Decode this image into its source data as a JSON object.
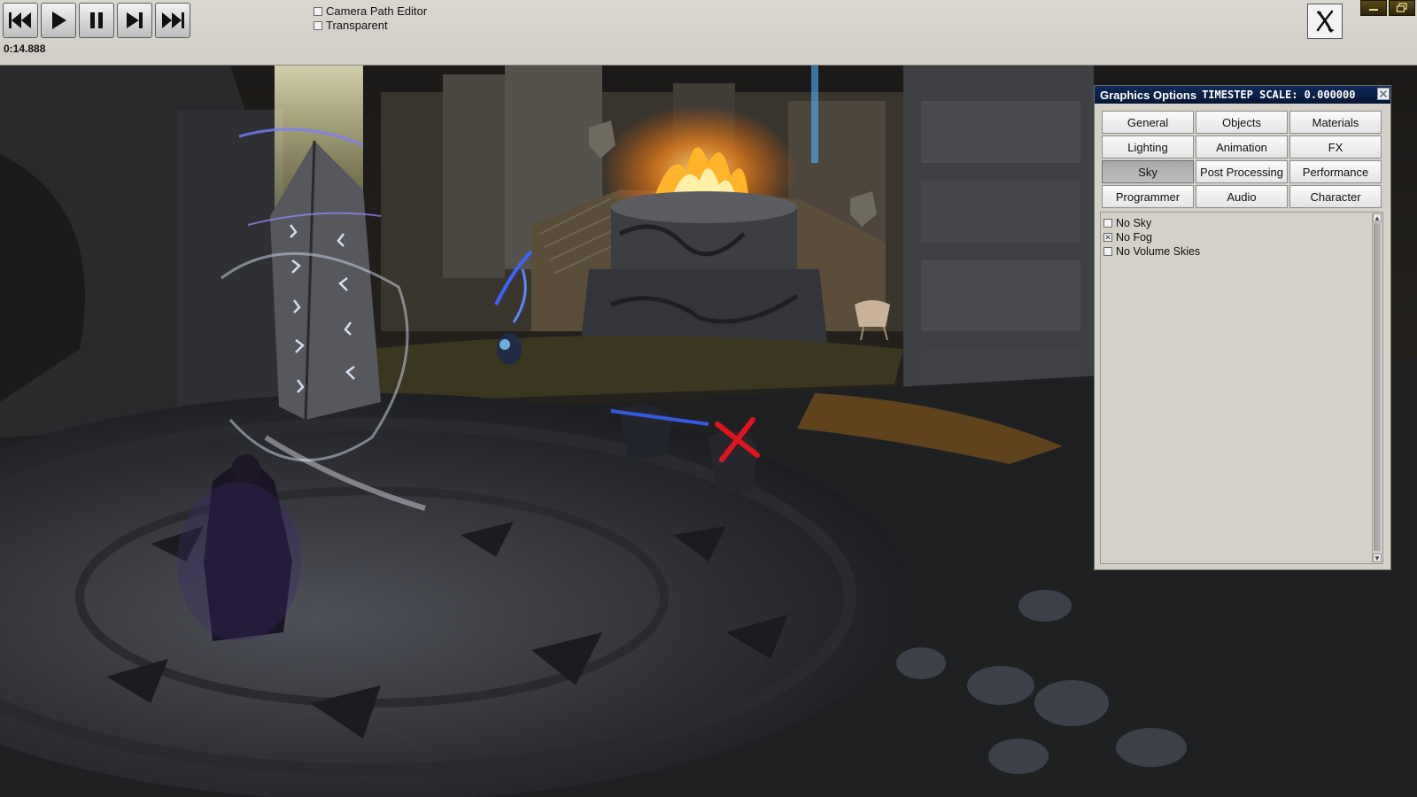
{
  "toolbar": {
    "buttons": [
      {
        "name": "rewind-button",
        "icon": "rewind-icon"
      },
      {
        "name": "play-button",
        "icon": "play-icon"
      },
      {
        "name": "pause-button",
        "icon": "pause-icon"
      },
      {
        "name": "step-forward-button",
        "icon": "step-forward-icon"
      },
      {
        "name": "fast-forward-button",
        "icon": "fast-forward-icon"
      }
    ],
    "time": "0:14.888",
    "camera_path_editor_label": "Camera Path Editor",
    "camera_path_editor_checked": false,
    "transparent_label": "Transparent",
    "transparent_checked": false,
    "close_icon": "x-icon",
    "window_controls": [
      "minimize-icon",
      "restore-icon"
    ]
  },
  "graphics_panel": {
    "title": "Graphics Options",
    "timestep": "TIMESTEP SCALE: 0.000000",
    "tabs": [
      {
        "label": "General"
      },
      {
        "label": "Objects"
      },
      {
        "label": "Materials"
      },
      {
        "label": "Lighting"
      },
      {
        "label": "Animation"
      },
      {
        "label": "FX"
      },
      {
        "label": "Sky",
        "active": true
      },
      {
        "label": "Post Processing"
      },
      {
        "label": "Performance"
      },
      {
        "label": "Programmer"
      },
      {
        "label": "Audio"
      },
      {
        "label": "Character"
      }
    ],
    "active_tab": "Sky",
    "options": [
      {
        "label": "No Sky",
        "checked": false
      },
      {
        "label": "No Fog",
        "checked": true
      },
      {
        "label": "No Volume Skies",
        "checked": false
      }
    ]
  },
  "colors": {
    "toolbar_bg": "#d4d2ca",
    "panel_bg": "#d4d1c8",
    "titlebar_bg": "#0b2048",
    "active_tab_bg": "#b0b0b0",
    "fire": "#ff8a1a",
    "light_beam": "#fff6a0",
    "blue_fx": "#3a64ff",
    "red_marker": "#e0141e"
  }
}
